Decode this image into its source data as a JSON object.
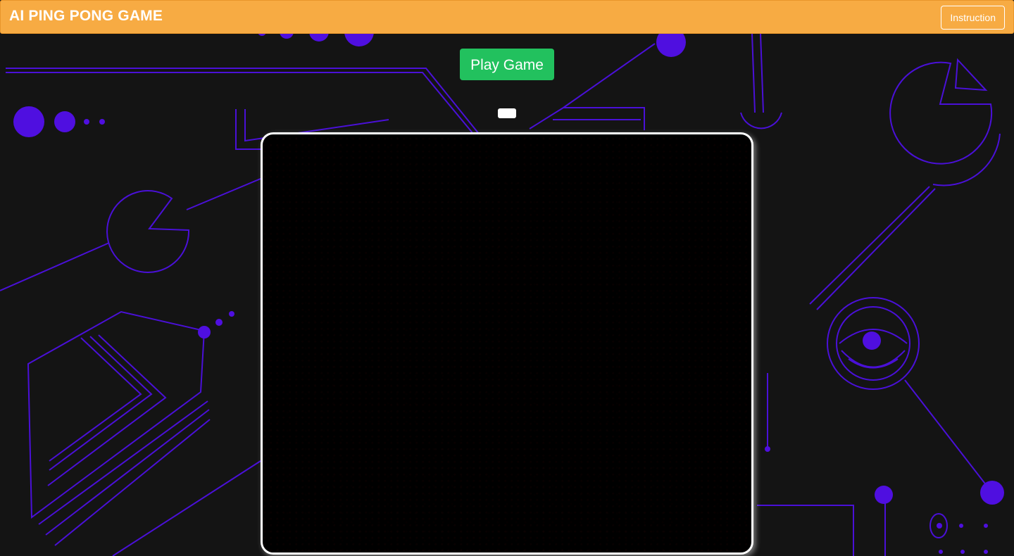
{
  "header": {
    "title": "AI PING PONG GAME",
    "instruction_label": "Instruction"
  },
  "controls": {
    "play_label": "Play Game"
  },
  "scoreboard": {
    "score_text": ""
  },
  "colors": {
    "header_bg": "#f7ab43",
    "play_button": "#22c15e",
    "background": "#141414",
    "decor_accent": "#4a0fd6",
    "board_bg": "#000000",
    "board_border": "#ffffff"
  },
  "icons": [
    "background-circuit-art"
  ]
}
